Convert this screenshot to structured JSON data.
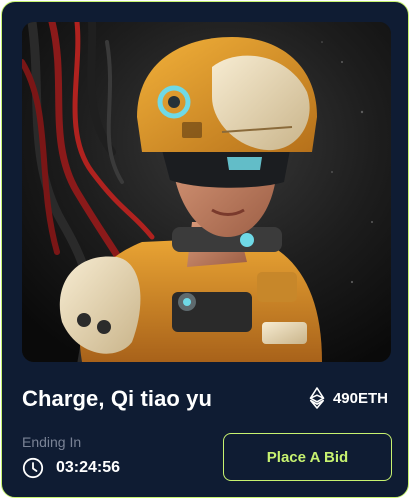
{
  "card": {
    "title": "Charge, Qi tiao yu",
    "price": "490ETH",
    "ending_label": "Ending In",
    "countdown": "03:24:56",
    "bid_button": "Place A Bid",
    "icons": {
      "price": "ethereum-icon",
      "timer": "clock-icon"
    }
  },
  "colors": {
    "card_background": "#0f1c33",
    "accent": "#c7f270",
    "text_primary": "#ffffff",
    "text_muted": "#7a8396"
  }
}
